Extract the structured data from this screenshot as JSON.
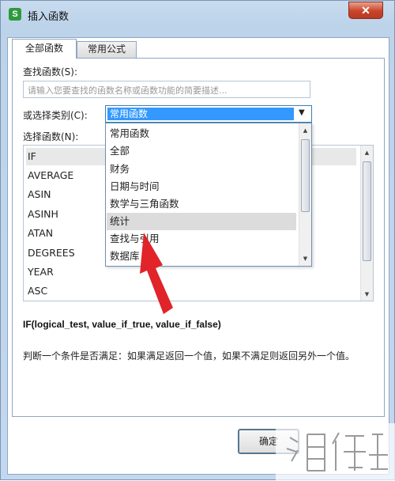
{
  "window": {
    "title": "插入函数",
    "app_icon_letter": "S",
    "close_symbol": "✕"
  },
  "tabs": [
    {
      "label": "全部函数",
      "active": true
    },
    {
      "label": "常用公式",
      "active": false
    }
  ],
  "search": {
    "label": "查找函数(S):",
    "placeholder": "请输入您要查找的函数名称或函数功能的简要描述..."
  },
  "category": {
    "label": "或选择类别(C):",
    "selected": "常用函数",
    "options": [
      "常用函数",
      "全部",
      "财务",
      "日期与时间",
      "数学与三角函数",
      "统计",
      "查找与引用",
      "数据库"
    ],
    "hovered_option": "统计"
  },
  "functions": {
    "label": "选择函数(N):",
    "items": [
      "IF",
      "AVERAGE",
      "ASIN",
      "ASINH",
      "ATAN",
      "DEGREES",
      "YEAR",
      "ASC"
    ],
    "selected": "IF"
  },
  "signature": "IF(logical_test, value_if_true, value_if_false)",
  "description": "判断一个条件是否满足：如果满足返回一个值，如果不满足则返回另外一个值。",
  "buttons": {
    "ok": "确定"
  },
  "colors": {
    "highlight": "#3399ff",
    "arrow": "#e0242a",
    "close": "#c9442b"
  }
}
